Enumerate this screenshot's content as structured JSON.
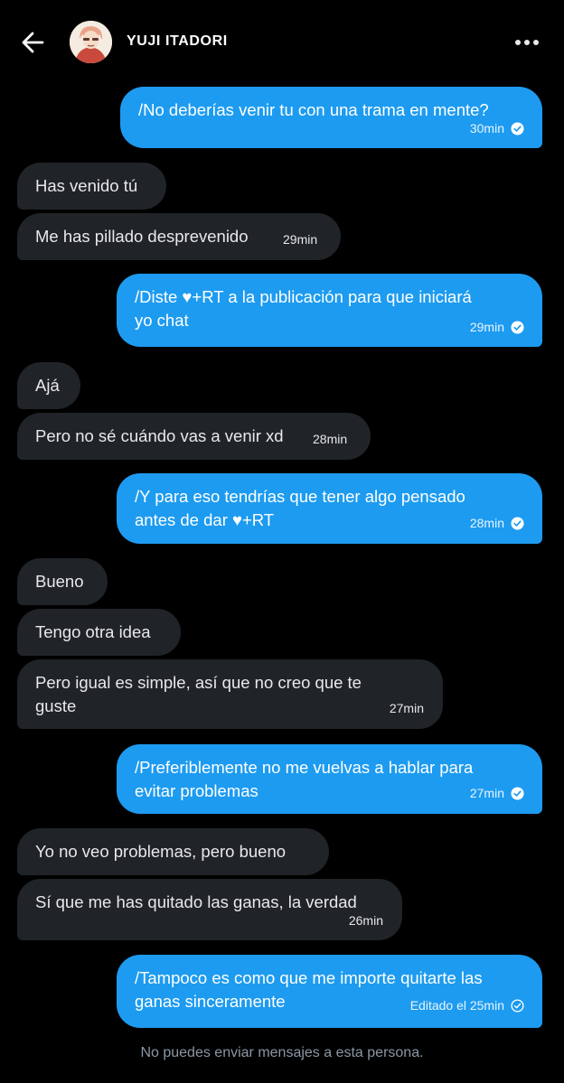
{
  "header": {
    "title": "YUJI ITADORI",
    "back_icon": "arrow-left-icon",
    "more_icon": "more-horizontal-icon"
  },
  "messages": [
    {
      "direction": "sent",
      "text": "/No deberías venir tu con una trama en mente?",
      "time": "30min",
      "read": true
    },
    {
      "direction": "received",
      "text": "Has venido tú",
      "time": ""
    },
    {
      "direction": "received",
      "text": "Me has pillado desprevenido",
      "time": "29min"
    },
    {
      "direction": "sent",
      "lines": [
        "/Diste ♥+RT a la publicación para que iniciará",
        "yo chat"
      ],
      "time": "29min",
      "read": true
    },
    {
      "direction": "received",
      "text": "Ajá",
      "time": ""
    },
    {
      "direction": "received",
      "text": "Pero no sé cuándo vas a venir xd",
      "time": "28min"
    },
    {
      "direction": "sent",
      "lines": [
        "/Y para eso tendrías que tener algo pensado",
        "antes de dar ♥+RT"
      ],
      "time": "28min",
      "read": true
    },
    {
      "direction": "received",
      "text": "Bueno",
      "time": ""
    },
    {
      "direction": "received",
      "text": "Tengo otra idea",
      "time": ""
    },
    {
      "direction": "received",
      "lines": [
        "Pero igual es simple, así que no creo que te",
        "guste"
      ],
      "time": "27min"
    },
    {
      "direction": "sent",
      "lines": [
        "/Preferiblemente no me vuelvas a hablar para",
        "evitar problemas"
      ],
      "time": "27min",
      "read": true
    },
    {
      "direction": "received",
      "text": "Yo no veo problemas, pero bueno",
      "time": ""
    },
    {
      "direction": "received",
      "text": "Sí que me has quitado las ganas, la verdad",
      "time": "26min"
    },
    {
      "direction": "sent",
      "lines": [
        "/Tampoco es como que me importe quitarte las",
        "ganas sinceramente"
      ],
      "time": "Editado el 25min",
      "read": false
    }
  ],
  "footer": {
    "note": "No puedes enviar mensajes a esta persona."
  },
  "colors": {
    "background": "#000000",
    "sent_bubble": "#1d9bf0",
    "received_bubble": "#202327",
    "muted_text": "#8b98a5"
  }
}
